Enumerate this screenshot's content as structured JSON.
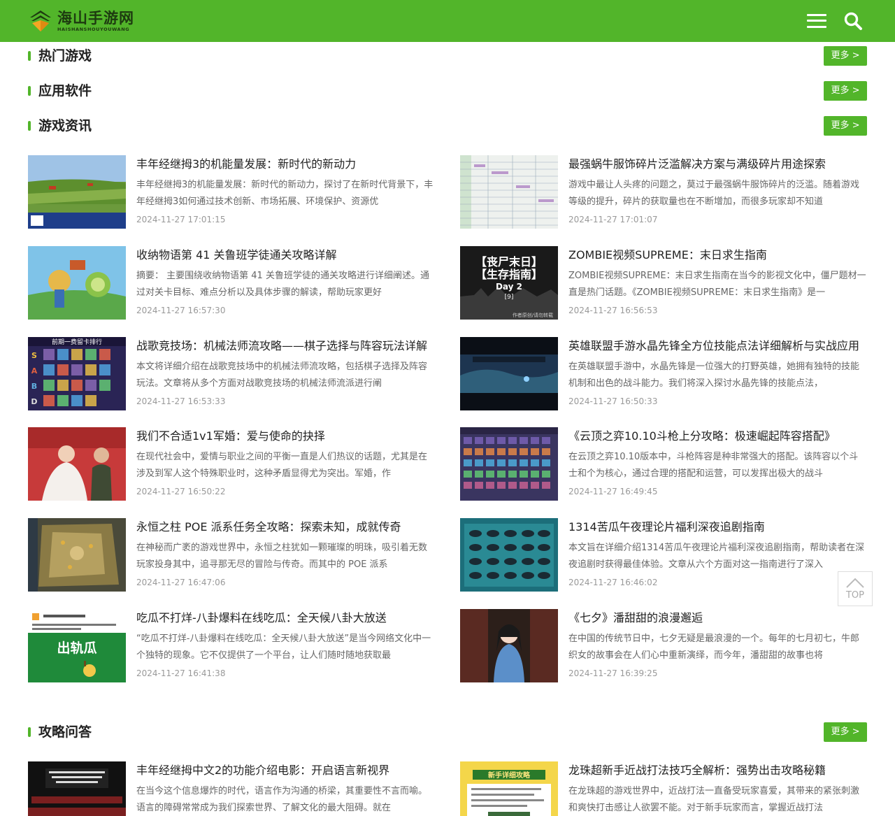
{
  "header": {
    "logo_title": "海山手游网",
    "logo_subtitle": "HAISHANSHOUYOUWANG",
    "brand_color": "#52b52a",
    "icons": [
      "menu-icon",
      "search-icon"
    ]
  },
  "sections": [
    {
      "title": "热门游戏",
      "more": "更多 >"
    },
    {
      "title": "应用软件",
      "more": "更多 >"
    },
    {
      "title": "游戏资讯",
      "more": "更多 >"
    },
    {
      "title": "攻略问答",
      "more": "更多 >"
    }
  ],
  "news": [
    {
      "title": "丰年经继拇3的机能量发展：新时代的新动力",
      "desc": "丰年经继拇3的机能量发展：新时代的新动力，探讨了在新时代背景下，丰年经继拇3如何通过技术创新、市场拓展、环境保护、资源优",
      "date": "2024-11-27 17:01:15"
    },
    {
      "title": "最强蜗牛服饰碎片泛滥解决方案与满级碎片用途探索",
      "desc": "游戏中最让人头疼的问题之，莫过于最强蜗牛服饰碎片的泛滥。随着游戏等级的提升，碎片的获取量也在不断增加，而很多玩家却不知道",
      "date": "2024-11-27 17:01:07"
    },
    {
      "title": "收纳物语第 41 关鲁班学徒通关攻略详解",
      "desc": "摘要： 主要围绕收纳物语第 41 关鲁班学徒的通关攻略进行详细阐述。通过对关卡目标、难点分析以及具体步骤的解读，帮助玩家更好",
      "date": "2024-11-27 16:57:30"
    },
    {
      "title": "ZOMBIE视频SUPREME：末日求生指南",
      "desc": "ZOMBIE视频SUPREME：末日求生指南在当今的影视文化中，僵尸题材一直是热门话题。《ZOMBIE视频SUPREME：末日求生指南》是一",
      "date": "2024-11-27 16:56:53"
    },
    {
      "title": "战歌竞技场：机械法师流攻略——棋子选择与阵容玩法详解",
      "desc": "本文将详细介绍在战歌竞技场中的机械法师流攻略，包括棋子选择及阵容玩法。文章将从多个方面对战歌竞技场的机械法师流派进行阐",
      "date": "2024-11-27 16:53:33"
    },
    {
      "title": "英雄联盟手游水晶先锋全方位技能点法详细解析与实战应用",
      "desc": "在英雄联盟手游中，水晶先锋是一位强大的打野英雄，她拥有独特的技能机制和出色的战斗能力。我们将深入探讨水晶先锋的技能点法，",
      "date": "2024-11-27 16:50:33"
    },
    {
      "title": "我们不合适1v1军婚：爱与使命的抉择",
      "desc": "在现代社会中，爱情与职业之间的平衡一直是人们热议的话题，尤其是在涉及到军人这个特殊职业时，这种矛盾显得尤为突出。军婚，作",
      "date": "2024-11-27 16:50:22"
    },
    {
      "title": "《云顶之弈10.10斗枪上分攻略：极速崛起阵容搭配》",
      "desc": "在云顶之弈10.10版本中，斗枪阵容是种非常强大的搭配。该阵容以个斗士和个为核心，通过合理的搭配和运营，可以发挥出极大的战斗",
      "date": "2024-11-27 16:49:45"
    },
    {
      "title": "永恒之柱 POE 派系任务全攻略：探索未知，成就传奇",
      "desc": "在神秘而广袤的游戏世界中，永恒之柱犹如一颗璀璨的明珠，吸引着无数玩家投身其中，追寻那无尽的冒险与传奇。而其中的 POE 派系",
      "date": "2024-11-27 16:47:06"
    },
    {
      "title": "1314苦瓜午夜理论片福利深夜追剧指南",
      "desc": "本文旨在详细介绍1314苦瓜午夜理论片福利深夜追剧指南，帮助读者在深夜追剧时获得最佳体验。文章从六个方面对这一指南进行了深入",
      "date": "2024-11-27 16:46:02"
    },
    {
      "title": "吃瓜不打烊-八卦爆料在线吃瓜：全天候八卦大放送",
      "desc": "“吃瓜不打烊-八卦爆料在线吃瓜：全天候八卦大放送”是当今网络文化中一个独特的现象。它不仅提供了一个平台，让人们随时随地获取最",
      "date": "2024-11-27 16:41:38"
    },
    {
      "title": "《七夕》潘甜甜的浪漫邂逅",
      "desc": "在中国的传统节日中，七夕无疑是最浪漫的一个。每年的七月初七，牛郎织女的故事会在人们心中重新演绎，而今年，潘甜甜的故事也将",
      "date": "2024-11-27 16:39:25"
    }
  ],
  "guides": [
    {
      "title": "丰年经继拇中文2的功能介绍电影：开启语言新视界",
      "desc": "在当今这个信息爆炸的时代，语言作为沟通的桥梁，其重要性不言而喻。语言的障碍常常成为我们探索世界、了解文化的最大阻碍。就在",
      "date": ""
    },
    {
      "title": "龙珠超新手近战打法技巧全解析：强势出击攻略秘籍",
      "desc": "在龙珠超的游戏世界中，近战打法一直备受玩家喜爱，其带来的紧张刺激和爽快打击感让人欲罢不能。对于新手玩家而言，掌握近战打法",
      "date": ""
    }
  ],
  "thumb_text": {
    "news_1": "【丧尸末日】【生存指南】Day 2 [9] 作者原创/请勿转载",
    "news_4": "前期一费留卡排行",
    "news_10": "出轨瓜",
    "guides_1": "新手详细攻略"
  },
  "back_to_top": "TOP"
}
